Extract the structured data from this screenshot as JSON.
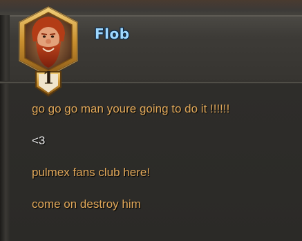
{
  "player": {
    "name": "Flob",
    "rank": "1",
    "portrait_icon": "dwarf-hero-portrait-icon"
  },
  "messages": [
    {
      "text": "go go go man youre going to do it !!!!!!",
      "color": "#e1a85a"
    },
    {
      "text": "<3",
      "color": "#eeeeee"
    },
    {
      "text": "pulmex fans club here!",
      "color": "#e1a85a"
    },
    {
      "text": "come on destroy him",
      "color": "#e1a85a"
    }
  ],
  "colors": {
    "name": "#9fd8ff",
    "message_gold": "#e1a85a",
    "message_white": "#eeeeee",
    "frame_gold": "#d9a640",
    "panel": "#2b2a27"
  }
}
